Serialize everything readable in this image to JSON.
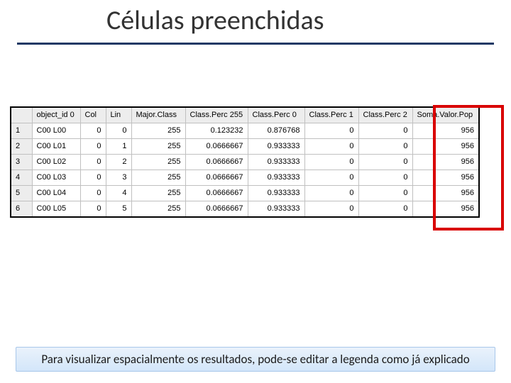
{
  "title": "Células preenchidas",
  "columns": [
    "",
    "object_id 0",
    "Col",
    "Lin",
    "Major.Class",
    "Class.Perc 255",
    "Class.Perc 0",
    "Class.Perc 1",
    "Class.Perc 2",
    "Soma.Valor.Pop"
  ],
  "rows": [
    {
      "n": "1",
      "obj": "C00 L00",
      "col": "0",
      "lin": "0",
      "major": "255",
      "p255": "0.123232",
      "p0": "0.876768",
      "p1": "0",
      "p2": "0",
      "soma": "956"
    },
    {
      "n": "2",
      "obj": "C00 L01",
      "col": "0",
      "lin": "1",
      "major": "255",
      "p255": "0.0666667",
      "p0": "0.933333",
      "p1": "0",
      "p2": "0",
      "soma": "956"
    },
    {
      "n": "3",
      "obj": "C00 L02",
      "col": "0",
      "lin": "2",
      "major": "255",
      "p255": "0.0666667",
      "p0": "0.933333",
      "p1": "0",
      "p2": "0",
      "soma": "956"
    },
    {
      "n": "4",
      "obj": "C00 L03",
      "col": "0",
      "lin": "3",
      "major": "255",
      "p255": "0.0666667",
      "p0": "0.933333",
      "p1": "0",
      "p2": "0",
      "soma": "956"
    },
    {
      "n": "5",
      "obj": "C00 L04",
      "col": "0",
      "lin": "4",
      "major": "255",
      "p255": "0.0666667",
      "p0": "0.933333",
      "p1": "0",
      "p2": "0",
      "soma": "956"
    },
    {
      "n": "6",
      "obj": "C00 L05",
      "col": "0",
      "lin": "5",
      "major": "255",
      "p255": "0.0666667",
      "p0": "0.933333",
      "p1": "0",
      "p2": "0",
      "soma": "956"
    }
  ],
  "footer": "Para visualizar espacialmente os resultados, pode-se editar a legenda como já explicado"
}
